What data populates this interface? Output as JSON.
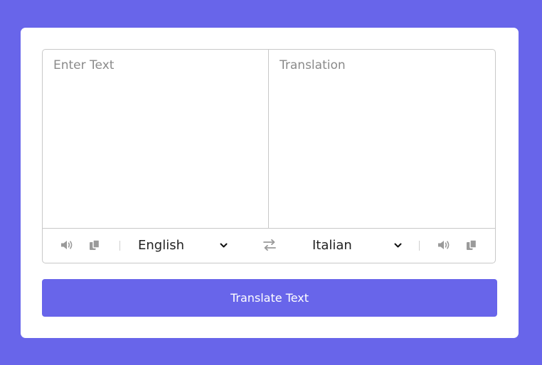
{
  "input": {
    "placeholder": "Enter Text",
    "value": ""
  },
  "output": {
    "placeholder": "Translation",
    "value": ""
  },
  "controls": {
    "from_language": "English",
    "to_language": "Italian",
    "icons": {
      "speak_from": "volume-icon",
      "copy_from": "copy-icon",
      "exchange": "exchange-icon",
      "speak_to": "volume-icon",
      "copy_to": "copy-icon",
      "chevron": "chevron-down-icon"
    }
  },
  "button": {
    "label": "Translate Text"
  },
  "colors": {
    "accent": "#6865ea",
    "card": "#ffffff",
    "border": "#c8c8c8",
    "icon": "#9a9a9a"
  }
}
